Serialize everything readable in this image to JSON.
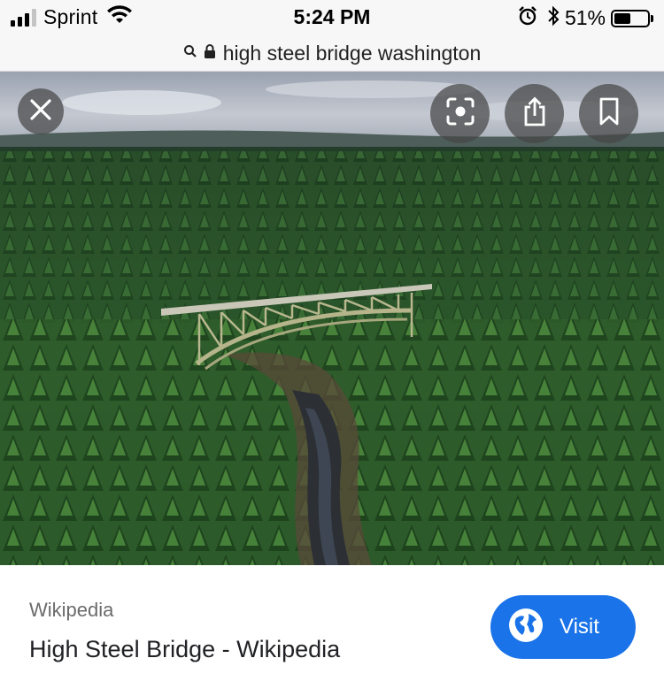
{
  "status_bar": {
    "carrier": "Sprint",
    "time": "5:24 PM",
    "battery_percent": "51%",
    "battery_level": 0.51,
    "signal_bars": 3,
    "signal_bars_total": 4
  },
  "url_bar": {
    "query": "high steel bridge washington"
  },
  "image_viewer": {
    "close_icon": "close-icon",
    "lens_icon": "lens-search-icon",
    "share_icon": "share-icon",
    "bookmark_icon": "bookmark-icon"
  },
  "result": {
    "source": "Wikipedia",
    "title": "High Steel Bridge - Wikipedia",
    "visit_label": "Visit",
    "visit_color": "#1a73e8"
  }
}
